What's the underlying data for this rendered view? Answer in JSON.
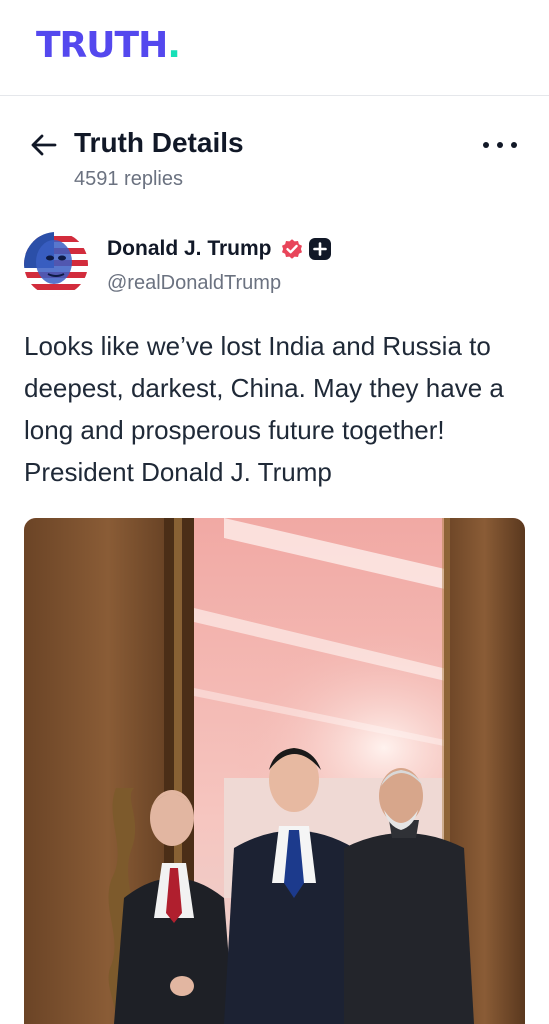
{
  "brand": {
    "logo_text": "TRUTH",
    "logo_dot": ".",
    "primary_color": "#5448ee",
    "accent_color": "#17e0b7"
  },
  "header": {
    "back_icon": "arrow-left-icon",
    "title": "Truth Details",
    "reply_count": "4591 replies",
    "menu_icon": "more-horizontal-icon"
  },
  "post": {
    "author": {
      "name": "Donald J. Trump",
      "handle": "@realDonaldTrump",
      "avatar_icon": "user-avatar-flag-portrait",
      "verified_icon": "verified-badge-icon",
      "verified_color": "#e8455a",
      "plus_icon": "plus-badge-icon"
    },
    "text": "Looks like we’ve lost India and Russia to deepest, darkest, China. May they have a long and prosperous future together! President Donald J. Trump",
    "media": {
      "type": "photo",
      "icon": "photo-three-leaders-walking"
    }
  }
}
